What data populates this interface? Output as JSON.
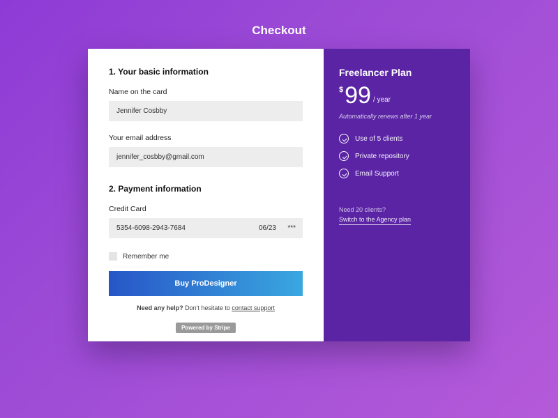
{
  "title": "Checkout",
  "form": {
    "section1": {
      "heading": "1.  Your basic information",
      "name_label": "Name on the card",
      "name_value": "Jennifer Cosbby",
      "email_label": "Your email address",
      "email_value": "jennifer_cosbby@gmail.com"
    },
    "section2": {
      "heading": "2.  Payment information",
      "cc_label": "Credit Card",
      "cc_number": "5354-6098-2943-7684",
      "cc_exp": "06/23",
      "cc_cvc": "***"
    },
    "remember_label": "Remember me",
    "buy_label": "Buy ProDesigner",
    "help_bold": "Need any help?",
    "help_rest": "  Don't hesitate to ",
    "help_link": "contact support",
    "powered": "Powered by Stripe"
  },
  "plan": {
    "name": "Freelancer Plan",
    "currency": "$",
    "price": "99",
    "per": "/ year",
    "renew": "Automatically renews after 1 year",
    "features": [
      "Use of 5 clients",
      "Private repository",
      "Email Support"
    ],
    "upsell_q": "Need 20 clients?",
    "upsell_link": "Switch to the Agency plan"
  },
  "colors": {
    "brand_purple": "#5a24a5",
    "gradient_start": "#2756c7",
    "gradient_end": "#3aa7e0"
  }
}
